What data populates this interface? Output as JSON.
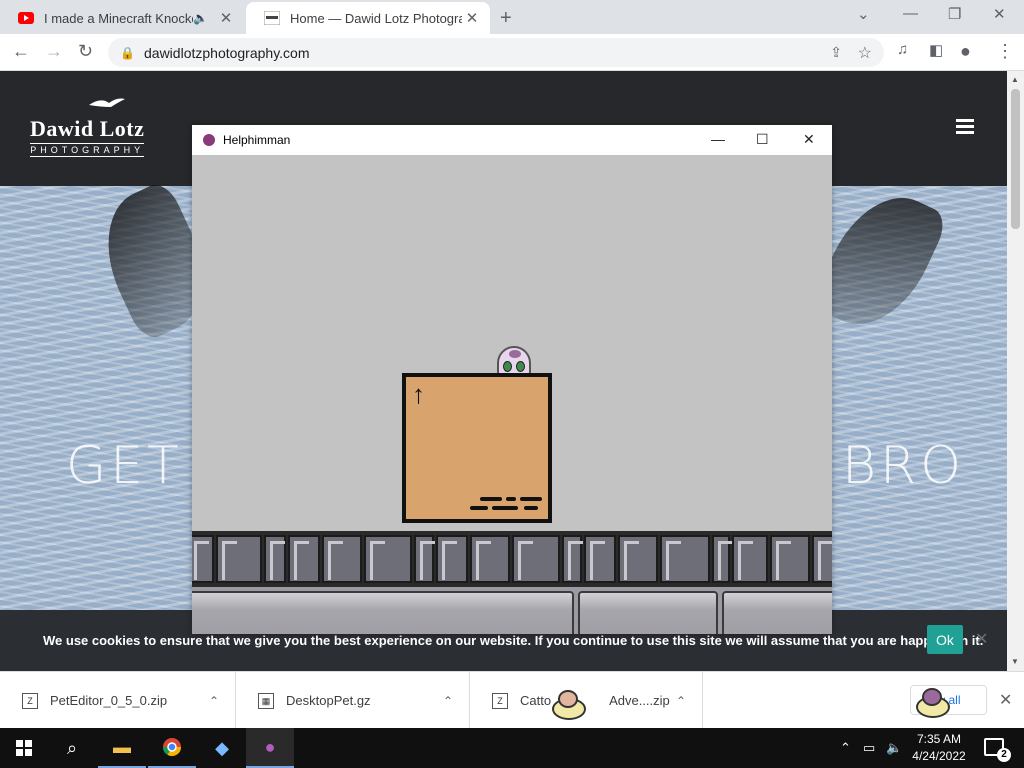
{
  "browser": {
    "tabs": [
      {
        "title": "I made a Minecraft Knockoff",
        "playing_audio": true
      },
      {
        "title": "Home — Dawid Lotz Photography",
        "active": true
      }
    ],
    "url": "dawidlotzphotography.com"
  },
  "website": {
    "logo_name": "Dawid Lotz",
    "logo_sub": "PHOTOGRAPHY",
    "hero_left": "GET I",
    "hero_right": "BRO",
    "cookie_message": "We use cookies to ensure that we give you the best experience on our website. If you continue to use this site we will assume that you are happy with it.",
    "cookie_ok": "Ok"
  },
  "game_window": {
    "title": "Helphimman"
  },
  "downloads": {
    "items": [
      {
        "name": "PetEditor_0_5_0.zip"
      },
      {
        "name": "DesktopPet.gz"
      },
      {
        "name_start": "Catto",
        "name_end": "Adve....zip"
      }
    ],
    "show_all": "w all"
  },
  "taskbar": {
    "time": "7:35 AM",
    "date": "4/24/2022",
    "notifications": "2"
  },
  "colors": {
    "cookie_ok": "#1fa195",
    "site_header": "#26282b",
    "box": "#d9a36d",
    "game_bg": "#c3c3c3"
  }
}
